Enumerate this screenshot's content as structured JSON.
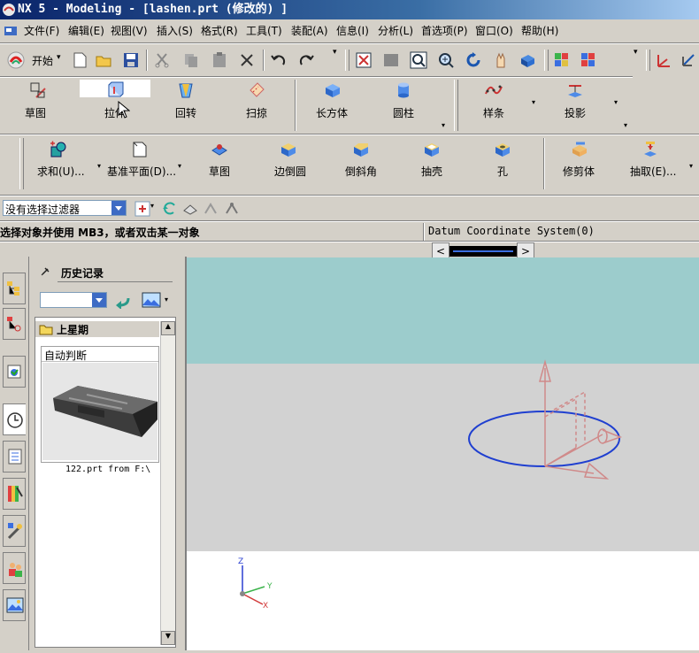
{
  "window": {
    "title": "NX 5 - Modeling - [lashen.prt  (修改的) ]"
  },
  "menu": [
    {
      "label": "文件(F)"
    },
    {
      "label": "编辑(E)"
    },
    {
      "label": "视图(V)"
    },
    {
      "label": "插入(S)"
    },
    {
      "label": "格式(R)"
    },
    {
      "label": "工具(T)"
    },
    {
      "label": "装配(A)"
    },
    {
      "label": "信息(I)"
    },
    {
      "label": "分析(L)"
    },
    {
      "label": "首选项(P)"
    },
    {
      "label": "窗口(O)"
    },
    {
      "label": "帮助(H)"
    }
  ],
  "standard_toolbar": {
    "start_label": "开始"
  },
  "feature_toolbar1": [
    {
      "label": "草图"
    },
    {
      "label": "拉伸"
    },
    {
      "label": "回转"
    },
    {
      "label": "扫掠"
    },
    {
      "label": "长方体"
    },
    {
      "label": "圆柱"
    },
    {
      "label": "样条"
    },
    {
      "label": "投影"
    }
  ],
  "feature_toolbar2": [
    {
      "label": "求和(U)..."
    },
    {
      "label": "基准平面(D)..."
    },
    {
      "label": "草图"
    },
    {
      "label": "边倒圆"
    },
    {
      "label": "倒斜角"
    },
    {
      "label": "抽壳"
    },
    {
      "label": "孔"
    },
    {
      "label": "修剪体"
    },
    {
      "label": "抽取(E)..."
    }
  ],
  "selection": {
    "filter_value": "没有选择过滤器"
  },
  "status": {
    "prompt": "选择对象并使用 MB3，或者双击某一对象",
    "selected": "Datum Coordinate System(0)"
  },
  "history": {
    "title": "历史记录",
    "group": "上星期",
    "item_title": "自动判断",
    "item_caption": "122.prt from F:\\"
  },
  "triad": {
    "x": "X",
    "y": "Y",
    "z": "Z"
  },
  "colors": {
    "viewport_top": "#9ccccc",
    "viewport_mid": "#d2d2d2",
    "circle": "#1f3fd0",
    "datum": "#d08a8a"
  }
}
